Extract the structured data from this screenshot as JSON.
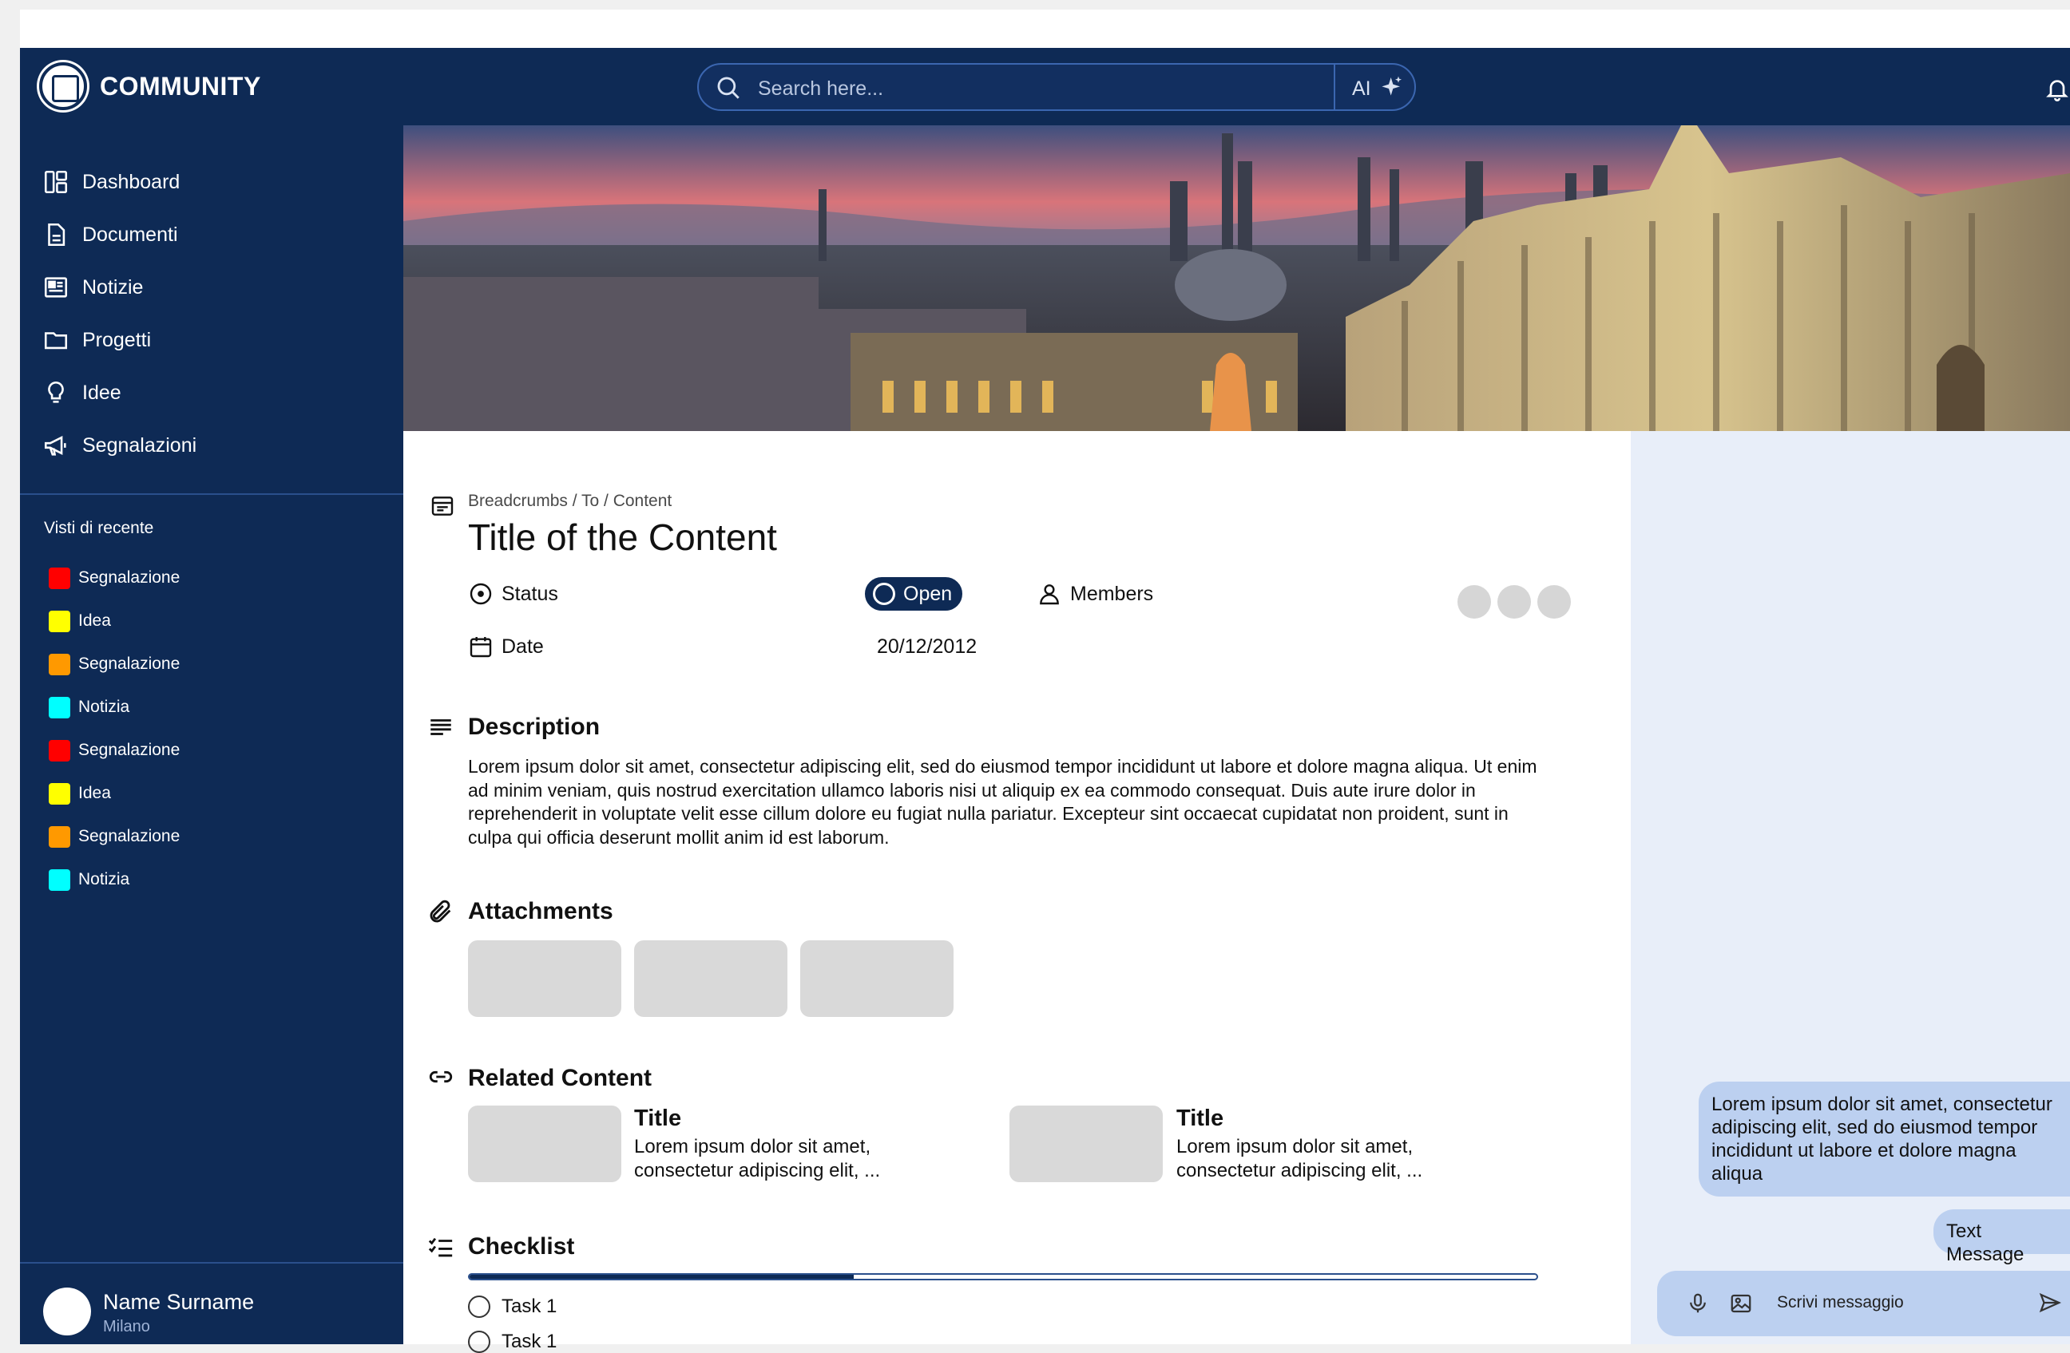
{
  "app": {
    "brand": "COMMUNITY"
  },
  "search": {
    "placeholder": "Search here...",
    "ai_label": "AI"
  },
  "sidebar": {
    "items": [
      {
        "label": "Dashboard",
        "icon": "dashboard-icon"
      },
      {
        "label": "Documenti",
        "icon": "document-icon"
      },
      {
        "label": "Notizie",
        "icon": "newspaper-icon"
      },
      {
        "label": "Progetti",
        "icon": "folder-icon"
      },
      {
        "label": "Idee",
        "icon": "lightbulb-icon"
      },
      {
        "label": "Segnalazioni",
        "icon": "megaphone-icon"
      }
    ],
    "recent_title": "Visti di recente",
    "recent": [
      {
        "label": "Segnalazione",
        "color": "#ff0000"
      },
      {
        "label": "Idea",
        "color": "#ffff00"
      },
      {
        "label": "Segnalazione",
        "color": "#ff9900"
      },
      {
        "label": "Notizia",
        "color": "#00ffff"
      },
      {
        "label": "Segnalazione",
        "color": "#ff0000"
      },
      {
        "label": "Idea",
        "color": "#ffff00"
      },
      {
        "label": "Segnalazione",
        "color": "#ff9900"
      },
      {
        "label": "Notizia",
        "color": "#00ffff"
      }
    ],
    "user": {
      "name": "Name Surname",
      "city": "Milano"
    }
  },
  "content": {
    "breadcrumbs": "Breadcrumbs / To / Content",
    "title": "Title of the Content",
    "status_label": "Status",
    "status_value": "Open",
    "members_label": "Members",
    "date_label": "Date",
    "date_value": "20/12/2012",
    "description_title": "Description",
    "description_text": "Lorem ipsum dolor sit amet, consectetur adipiscing elit, sed do eiusmod tempor incididunt ut labore et dolore magna aliqua. Ut enim ad minim veniam, quis nostrud exercitation ullamco laboris nisi ut aliquip ex ea commodo consequat. Duis aute irure dolor in reprehenderit in voluptate velit esse cillum dolore eu fugiat nulla pariatur. Excepteur sint occaecat cupidatat non proident, sunt in culpa qui officia deserunt mollit anim id est laborum.",
    "attachments_title": "Attachments",
    "related_title": "Related Content",
    "related": [
      {
        "title": "Title",
        "text": "Lorem ipsum dolor sit amet, consectetur adipiscing elit, ..."
      },
      {
        "title": "Title",
        "text": "Lorem ipsum dolor sit amet, consectetur adipiscing elit, ..."
      }
    ],
    "checklist_title": "Checklist",
    "checklist_progress": 0.36,
    "tasks": [
      {
        "label": "Task 1"
      },
      {
        "label": "Task 1"
      }
    ]
  },
  "chat": {
    "messages": [
      "Lorem ipsum dolor sit amet, consectetur adipiscing elit, sed do eiusmod tempor incididunt ut labore et dolore magna aliqua",
      "Text Message"
    ],
    "input_placeholder": "Scrivi messaggio"
  },
  "colors": {
    "primary": "#0e2a55",
    "chat_bg": "#e8eef9",
    "bubble": "#bcd0f0"
  }
}
